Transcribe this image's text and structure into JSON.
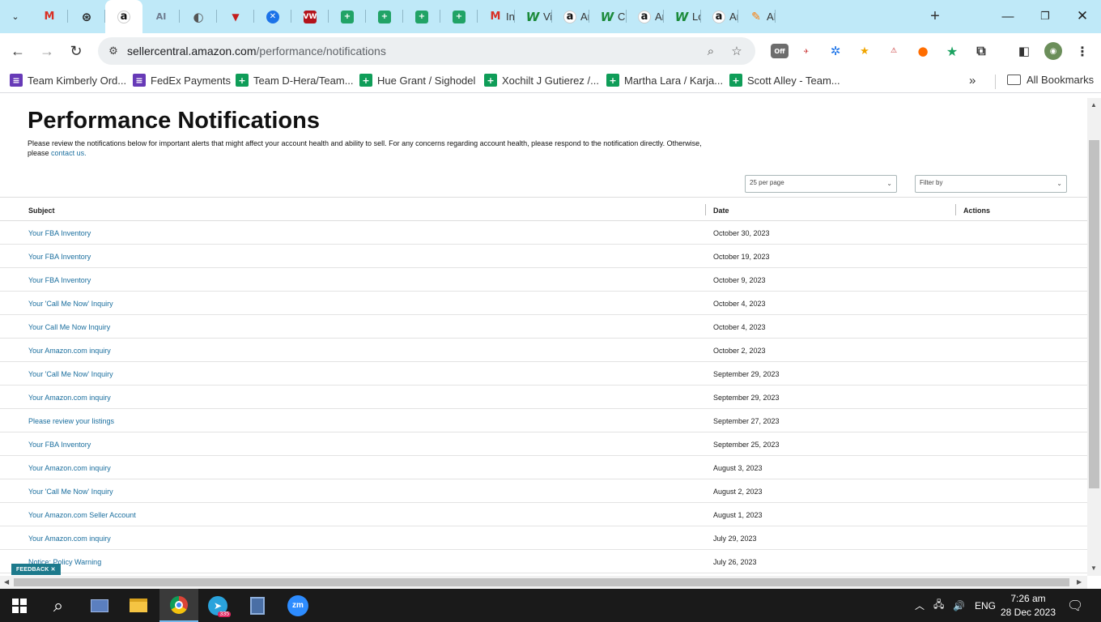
{
  "browser": {
    "tabs": [
      {
        "icon": "gmail-icon",
        "glyph": "M",
        "title": ""
      },
      {
        "icon": "chatgpt-icon",
        "glyph": "⊛",
        "title": ""
      },
      {
        "icon": "amazon-icon",
        "glyph": "a",
        "title": "",
        "active": true
      },
      {
        "icon": "ai-icon",
        "glyph": "AI",
        "title": ""
      },
      {
        "icon": "globe-icon",
        "glyph": "◐",
        "title": ""
      },
      {
        "icon": "triangle-icon",
        "glyph": "▼",
        "title": ""
      },
      {
        "icon": "blue-x-icon",
        "glyph": "✕",
        "title": ""
      },
      {
        "icon": "vw-icon",
        "glyph": "VW",
        "title": ""
      },
      {
        "icon": "sheets-icon",
        "glyph": "+",
        "title": ""
      },
      {
        "icon": "sheets-icon",
        "glyph": "+",
        "title": ""
      },
      {
        "icon": "sheets-icon",
        "glyph": "+",
        "title": ""
      },
      {
        "icon": "sheets-icon",
        "glyph": "+",
        "title": ""
      },
      {
        "icon": "gmail-icon",
        "glyph": "M",
        "title": "Inbo"
      },
      {
        "icon": "w-logo-icon",
        "glyph": "W",
        "title": "Victo"
      },
      {
        "icon": "amazon-icon",
        "glyph": "a",
        "title": "Ama"
      },
      {
        "icon": "w-logo-icon",
        "glyph": "W",
        "title": "Clan"
      },
      {
        "icon": "amazon-icon",
        "glyph": "a",
        "title": "Ama"
      },
      {
        "icon": "w-logo-icon",
        "glyph": "W",
        "title": "LorA"
      },
      {
        "icon": "amazon-icon",
        "glyph": "a",
        "title": "Ama"
      },
      {
        "icon": "pen-icon",
        "glyph": "✎",
        "title": "AMZ"
      }
    ],
    "url_domain": "sellercentral.amazon.com",
    "url_path": "/performance/notifications",
    "bookmarks": [
      {
        "label": "Team Kimberly Ord...",
        "icon": "purple"
      },
      {
        "label": "FedEx Payments",
        "icon": "purple"
      },
      {
        "label": "Team D-Hera/Team...",
        "icon": "green"
      },
      {
        "label": "Hue Grant / Sighodel",
        "icon": "green"
      },
      {
        "label": "Xochilt J Gutierez /...",
        "icon": "green"
      },
      {
        "label": "Martha Lara / Karja...",
        "icon": "green"
      },
      {
        "label": "Scott Alley - Team...",
        "icon": "green"
      }
    ],
    "all_bookmarks": "All Bookmarks",
    "extension_off_label": "Off"
  },
  "page": {
    "title": "Performance Notifications",
    "description": "Please review the notifications below for important alerts that might affect your account health and ability to sell. For any concerns regarding account health, please respond to the notification directly. Otherwise, please",
    "contact_link": "contact us.",
    "per_page": "25 per page",
    "filter": "Filter by",
    "columns": {
      "subject": "Subject",
      "date": "Date",
      "actions": "Actions"
    },
    "rows": [
      {
        "subject": "Your FBA Inventory",
        "date": "October 30, 2023"
      },
      {
        "subject": "Your FBA Inventory",
        "date": "October 19, 2023"
      },
      {
        "subject": "Your FBA Inventory",
        "date": "October 9, 2023"
      },
      {
        "subject": "Your 'Call Me Now' Inquiry",
        "date": "October 4, 2023"
      },
      {
        "subject": "Your Call Me Now Inquiry",
        "date": "October 4, 2023"
      },
      {
        "subject": "Your Amazon.com inquiry",
        "date": "October 2, 2023"
      },
      {
        "subject": "Your 'Call Me Now' Inquiry",
        "date": "September 29, 2023"
      },
      {
        "subject": "Your Amazon.com inquiry",
        "date": "September 29, 2023"
      },
      {
        "subject": "Please review your listings",
        "date": "September 27, 2023"
      },
      {
        "subject": "Your FBA Inventory",
        "date": "September 25, 2023"
      },
      {
        "subject": "Your Amazon.com inquiry",
        "date": "August 3, 2023"
      },
      {
        "subject": "Your 'Call Me Now' Inquiry",
        "date": "August 2, 2023"
      },
      {
        "subject": "Your Amazon.com Seller Account",
        "date": "August 1, 2023"
      },
      {
        "subject": "Your Amazon.com inquiry",
        "date": "July 29, 2023"
      },
      {
        "subject": "Notice: Policy Warning",
        "date": "July 26, 2023"
      }
    ],
    "feedback": "FEEDBACK"
  },
  "taskbar": {
    "language": "ENG",
    "time": "7:26 am",
    "date": "28 Dec 2023",
    "telegram_badge": "335"
  }
}
